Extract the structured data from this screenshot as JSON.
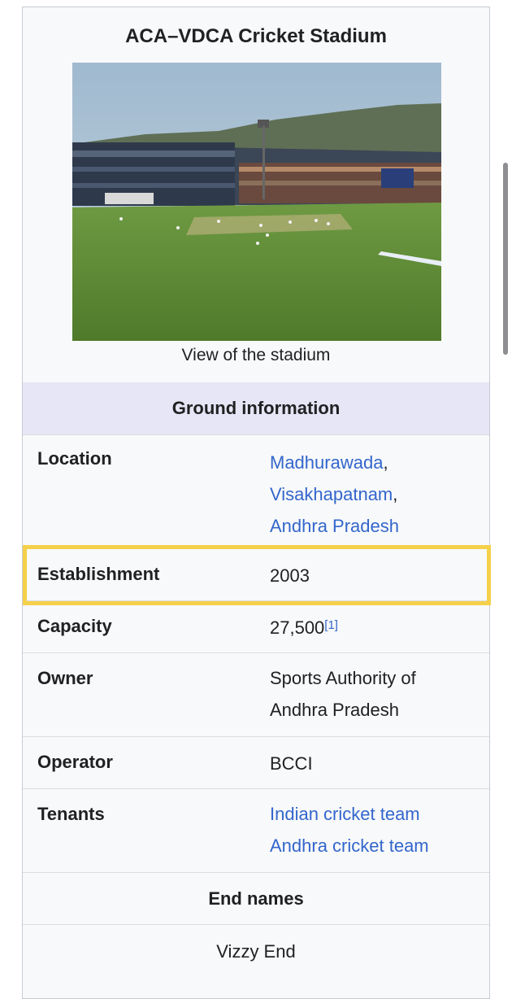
{
  "infobox": {
    "title": "ACA–VDCA Cricket Stadium",
    "image_caption": "View of the stadium",
    "ground_info_header": "Ground information",
    "rows": {
      "location": {
        "label": "Location",
        "links": [
          "Madhurawada",
          "Visakhapatnam",
          "Andhra Pradesh"
        ],
        "separators": [
          ",",
          ","
        ]
      },
      "establishment": {
        "label": "Establishment",
        "value": "2003"
      },
      "capacity": {
        "label": "Capacity",
        "value": "27,500",
        "ref": "[1]"
      },
      "owner": {
        "label": "Owner",
        "lines": [
          "Sports Authority of",
          "Andhra Pradesh"
        ]
      },
      "operator": {
        "label": "Operator",
        "value": "BCCI"
      },
      "tenants": {
        "label": "Tenants",
        "links": [
          "Indian cricket team",
          "Andhra cricket team"
        ]
      }
    },
    "end_names_header": "End names",
    "end_names": [
      "Vizzy End"
    ]
  },
  "colors": {
    "link": "#3366cc",
    "header_bg": "#e6e6f7",
    "highlight": "#f5d04a",
    "infobox_bg": "#f8f9fa"
  }
}
